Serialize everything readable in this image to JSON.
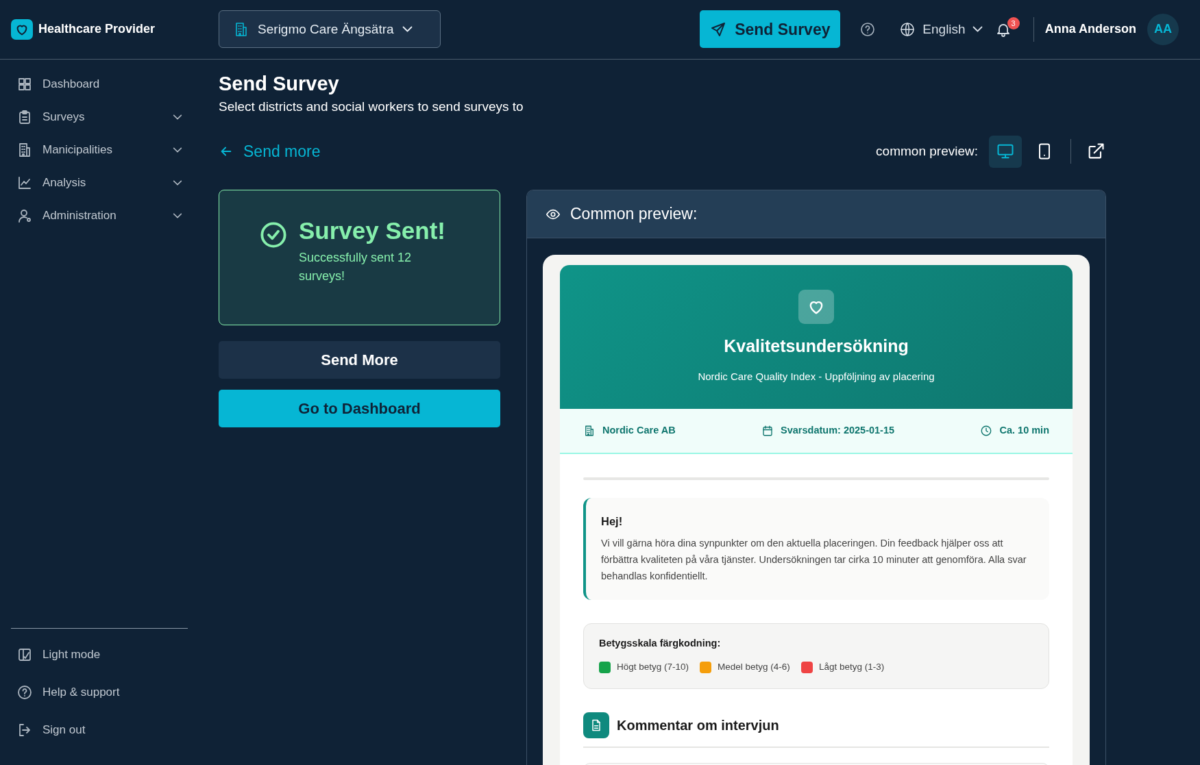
{
  "header": {
    "brand": "Healthcare Provider",
    "facility": "Serigmo Care Ängsätra",
    "send_button": "Send Survey",
    "language": "English",
    "notification_count": "3",
    "user_name": "Anna Anderson",
    "user_initials": "AA"
  },
  "sidebar": {
    "items": [
      {
        "kind": "grid",
        "label": "Dashboard",
        "submenu": false
      },
      {
        "kind": "clipboard",
        "label": "Surveys",
        "submenu": true
      },
      {
        "kind": "building",
        "label": "Manicipalities",
        "submenu": true
      },
      {
        "kind": "chart",
        "label": "Analysis",
        "submenu": true
      },
      {
        "kind": "user",
        "label": "Administration",
        "submenu": true
      }
    ],
    "footer": [
      {
        "kind": "theme",
        "label": "Light mode"
      },
      {
        "kind": "help",
        "label": "Help & support"
      },
      {
        "kind": "logout",
        "label": "Sign out"
      }
    ]
  },
  "page": {
    "title": "Send Survey",
    "subtitle": "Select districts and social workers to send surveys to",
    "back_link": "Send more",
    "preview_mode": {
      "label": "common preview:",
      "options": [
        {
          "kind": "desktop",
          "selected": true
        },
        {
          "kind": "tablet",
          "selected": false
        }
      ]
    },
    "success": {
      "title": "Survey Sent!",
      "message": "Successfully sent 12 surveys!"
    },
    "buttons": [
      {
        "kind": "secondary",
        "label": "Send More"
      },
      {
        "kind": "primary",
        "label": "Go to Dashboard"
      }
    ],
    "preview": {
      "title": "Common preview:",
      "survey": {
        "title": "Kvalitetsundersökning",
        "subtitle": "Nordic Care Quality Index - Uppföljning av placering",
        "meta": [
          {
            "kind": "organization",
            "text": "Nordic Care AB"
          },
          {
            "kind": "date",
            "text": "Svarsdatum: 2025-01-15"
          },
          {
            "kind": "duration",
            "text": "Ca. 10 min"
          }
        ],
        "intro": {
          "heading": "Hej!",
          "text": "Vi vill gärna höra dina synpunkter om den aktuella placeringen. Din feedback hjälper oss att förbättra kvaliteten på våra tjänster. Undersökningen tar cirka 10 minuter att genomföra. Alla svar behandlas konfidentiellt."
        },
        "legend": {
          "title": "Betygsskala färgkodning:",
          "items": [
            {
              "label": "Högt betyg (7-10)",
              "color": "#16a34a"
            },
            {
              "label": "Medel betyg (4-6)",
              "color": "#f59e0b"
            },
            {
              "label": "Lågt betyg (1-3)",
              "color": "#ef4444"
            }
          ]
        },
        "section": {
          "title": "Kommentar om intervjun"
        }
      }
    }
  }
}
